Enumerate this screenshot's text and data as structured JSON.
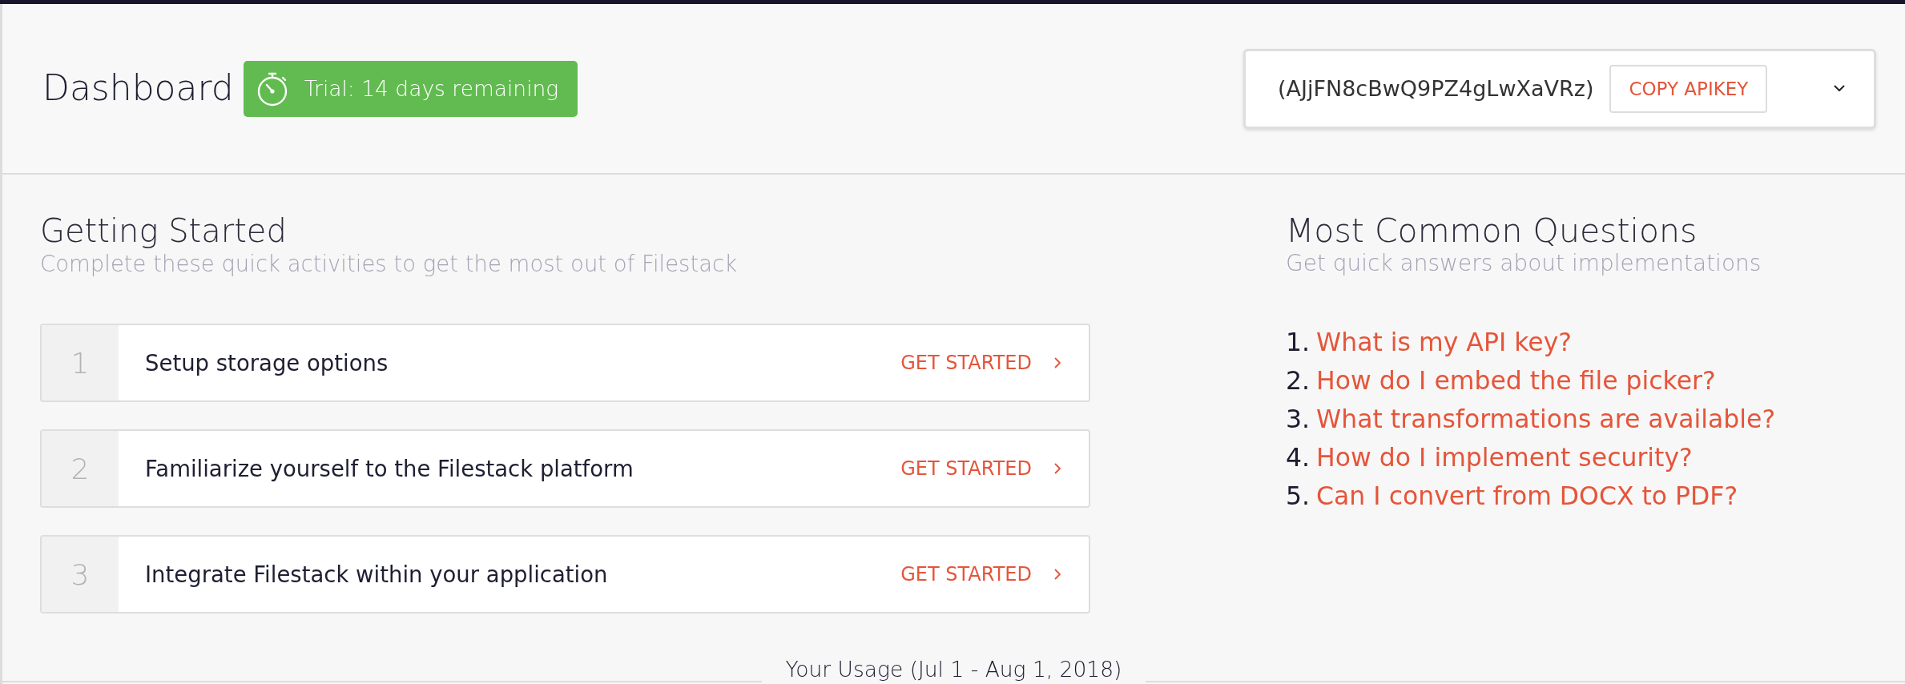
{
  "header": {
    "title": "Dashboard",
    "trial_badge": "Trial: 14 days remaining",
    "api_key": "(AJjFN8cBwQ9PZ4gLwXaVRz)",
    "copy_button": "COPY APIKEY",
    "api_menu": {
      "expanded": false
    }
  },
  "getting_started": {
    "title": "Getting Started",
    "subtitle": "Complete these quick activities to get the most out of Filestack",
    "steps": [
      {
        "number": "1",
        "title": "Setup storage options",
        "action": "GET STARTED"
      },
      {
        "number": "2",
        "title": "Familiarize yourself to the Filestack platform",
        "action": "GET STARTED"
      },
      {
        "number": "3",
        "title": "Integrate Filestack within your application",
        "action": "GET STARTED"
      }
    ]
  },
  "questions": {
    "title": "Most Common Questions",
    "subtitle": "Get quick answers about implementations",
    "items": [
      {
        "number": "1.",
        "text": "What is my API key?"
      },
      {
        "number": "2.",
        "text": "How do I embed the file picker?"
      },
      {
        "number": "3.",
        "text": "What transformations are available?"
      },
      {
        "number": "4.",
        "text": "How do I implement security?"
      },
      {
        "number": "5.",
        "text": "Can I convert from DOCX to PDF?"
      }
    ]
  },
  "usage": {
    "title": "Your Usage (Jul 1 - Aug 1, 2018)"
  }
}
